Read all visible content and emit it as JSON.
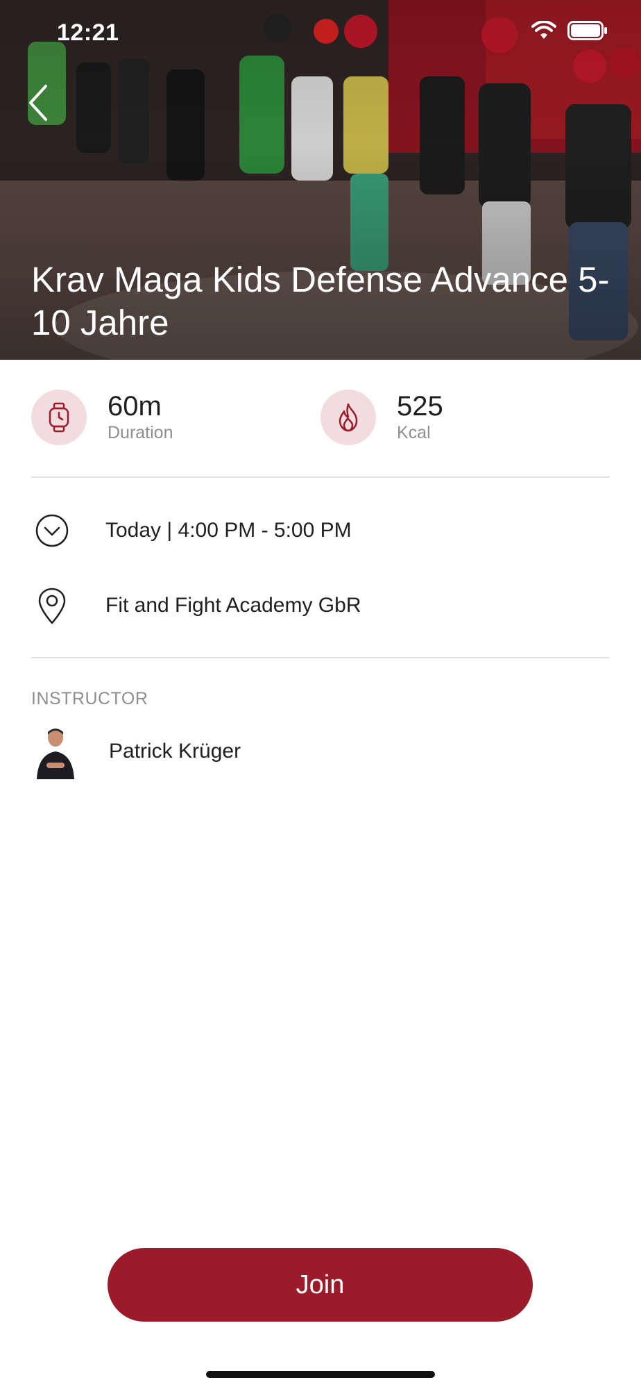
{
  "status_bar": {
    "time": "12:21",
    "icons": [
      "wifi-icon",
      "battery-icon"
    ]
  },
  "hero": {
    "title": "Krav Maga Kids Defense Advance 5-10 Jahre",
    "back_icon": "chevron-left-icon"
  },
  "stats": {
    "duration": {
      "value": "60m",
      "label": "Duration",
      "icon": "watch-icon"
    },
    "calories": {
      "value": "525",
      "label": "Kcal",
      "icon": "flame-icon"
    }
  },
  "details": {
    "time": {
      "text": "Today | 4:00 PM - 5:00 PM",
      "icon": "clock-chevron-icon"
    },
    "location": {
      "text": "Fit and Fight Academy GbR",
      "icon": "map-pin-icon"
    }
  },
  "instructor": {
    "section_label": "INSTRUCTOR",
    "name": "Patrick Krüger"
  },
  "actions": {
    "join_label": "Join"
  },
  "colors": {
    "accent": "#9c1b2b",
    "icon_bg": "#f2dcdf",
    "divider": "#e1e1e1",
    "secondary_text": "#8e8e93"
  }
}
